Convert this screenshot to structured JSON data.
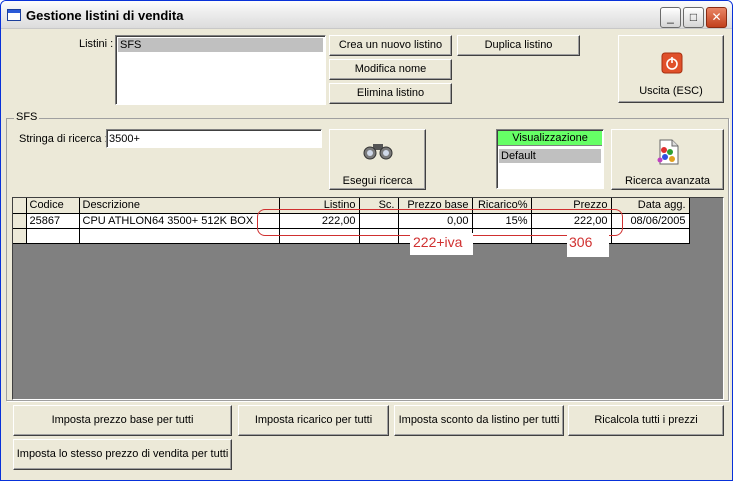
{
  "window": {
    "title": "Gestione listini di vendita",
    "controls": {
      "minimize": "_",
      "maximize": "□",
      "close": "✕"
    }
  },
  "listini": {
    "label": "Listini :",
    "items": [
      "SFS"
    ],
    "buttons": {
      "new": "Crea un nuovo listino",
      "rename": "Modifica nome",
      "delete": "Elimina listino",
      "duplicate": "Duplica listino"
    },
    "exit_label": "Uscita (ESC)"
  },
  "group": {
    "title": "SFS",
    "search_label": "Stringa di ricerca :",
    "search_value": "3500+",
    "search_button": "Esegui ricerca",
    "view_header": "Visualizzazione",
    "view_items": [
      "Default"
    ],
    "advanced_button": "Ricerca avanzata"
  },
  "grid": {
    "columns": [
      "Codice",
      "Descrizione",
      "Listino",
      "Sc.",
      "Prezzo base",
      "Ricarico%",
      "Prezzo",
      "Data agg."
    ],
    "rows": [
      {
        "codice": "25867",
        "descrizione": "CPU ATHLON64 3500+ 512K BOX",
        "listino": "222,00",
        "sc": "",
        "prezzo_base": "0,00",
        "ricarico": "15%",
        "prezzo": "222,00",
        "data": "08/06/2005"
      }
    ]
  },
  "notes": {
    "note1": "222+iva",
    "note2": "306"
  },
  "bottom_buttons": {
    "base_price": "Imposta prezzo base per tutti",
    "markup": "Imposta ricarico per tutti",
    "discount": "Imposta sconto da listino per tutti",
    "recalc": "Ricalcola tutti i prezzi",
    "same_price": "Imposta lo stesso prezzo di vendita per tutti"
  },
  "colors": {
    "accent_green": "#66ff66",
    "annotation_red": "#d03030",
    "window_bg": "#ece9d8"
  }
}
